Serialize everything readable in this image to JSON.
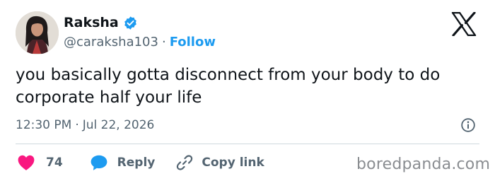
{
  "author": {
    "name": "Raksha",
    "handle": "@caraksha103",
    "separator": "·",
    "follow_label": "Follow",
    "verified": true
  },
  "tweet": {
    "text": "you basically gotta disconnect from your body to do corporate half your life",
    "time": "12:30 PM",
    "date_separator": "·",
    "date": "Jul 22, 2026"
  },
  "actions": {
    "likes": "74",
    "reply_label": "Reply",
    "copy_label": "Copy link"
  },
  "watermark": "boredpanda.com",
  "icons": {
    "brand": "x-logo-icon",
    "verified": "verified-badge-icon",
    "info": "info-icon",
    "like": "heart-icon",
    "reply": "chat-bubble-icon",
    "copy": "link-icon"
  },
  "colors": {
    "accent": "#1d9bf0",
    "like": "#f91880",
    "text": "#0f1419",
    "muted": "#536471",
    "watermark": "#8a8d91"
  }
}
